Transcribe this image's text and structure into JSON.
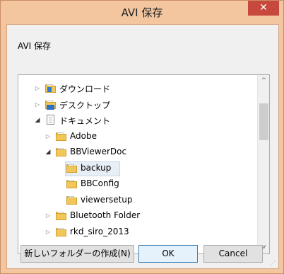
{
  "window": {
    "title": "AVI 保存",
    "close_glyph": "✕"
  },
  "dialog": {
    "description": "AVI 保存"
  },
  "tree": {
    "items": [
      {
        "label": "ダウンロード",
        "level": 1,
        "expander": "collapsed",
        "icon": "downloads-folder-icon"
      },
      {
        "label": "デスクトップ",
        "level": 1,
        "expander": "collapsed",
        "icon": "desktop-folder-icon"
      },
      {
        "label": "ドキュメント",
        "level": 1,
        "expander": "expanded",
        "icon": "documents-icon"
      },
      {
        "label": "Adobe",
        "level": 2,
        "expander": "collapsed",
        "icon": "folder-icon"
      },
      {
        "label": "BBViewerDoc",
        "level": 2,
        "expander": "expanded",
        "icon": "folder-icon"
      },
      {
        "label": "backup",
        "level": 3,
        "expander": "none",
        "icon": "folder-icon",
        "selected": true
      },
      {
        "label": "BBConfig",
        "level": 3,
        "expander": "none",
        "icon": "folder-icon"
      },
      {
        "label": "viewersetup",
        "level": 3,
        "expander": "none",
        "icon": "folder-icon"
      },
      {
        "label": "Bluetooth Folder",
        "level": 2,
        "expander": "collapsed",
        "icon": "folder-icon"
      },
      {
        "label": "rkd_siro_2013",
        "level": 2,
        "expander": "collapsed",
        "icon": "folder-icon"
      }
    ]
  },
  "scrollbar": {
    "up_glyph": "^",
    "down_glyph": "v"
  },
  "buttons": {
    "new_folder": "新しいフォルダーの作成(N)",
    "ok": "OK",
    "cancel": "Cancel"
  },
  "colors": {
    "frame": "#f3c6a0",
    "close": "#c7483c",
    "selection": "#e8eef6"
  }
}
